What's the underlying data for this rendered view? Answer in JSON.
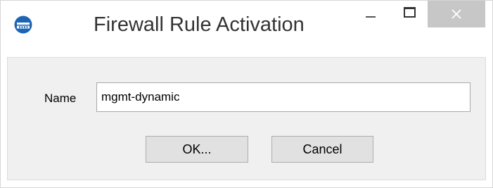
{
  "window": {
    "title": "Firewall Rule Activation",
    "controls": {
      "minimize_icon": "minimize-icon",
      "maximize_icon": "maximize-icon",
      "close_icon": "close-icon"
    },
    "app_icon": "firewall-app-icon"
  },
  "form": {
    "name_label": "Name",
    "name_value": "mgmt-dynamic"
  },
  "buttons": {
    "ok_label": "OK...",
    "cancel_label": "Cancel"
  },
  "colors": {
    "app_icon_blue": "#1d64b4",
    "close_button_bg": "#c7c7c7",
    "client_bg": "#f0f0f0",
    "button_bg": "#e1e1e1"
  }
}
